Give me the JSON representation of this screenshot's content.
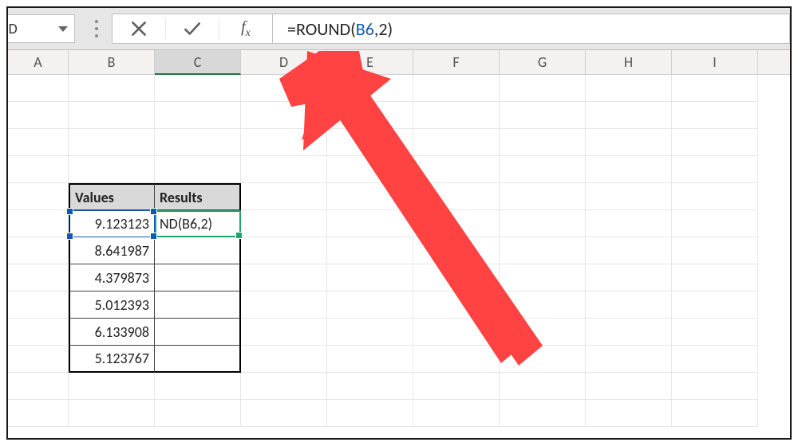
{
  "namebox": {
    "value": "ND"
  },
  "formula_bar": {
    "prefix": "=ROUND(",
    "ref": "B6",
    "suffix": ",2)"
  },
  "columns": [
    "A",
    "B",
    "C",
    "D",
    "E",
    "F",
    "G",
    "H",
    "I"
  ],
  "table": {
    "headers": {
      "b": "Values",
      "c": "Results"
    },
    "active_cell_display": "ND(B6,2)",
    "values": [
      "9.123123",
      "8.641987",
      "4.379873",
      "5.012393",
      "6.133908",
      "5.123767"
    ]
  },
  "chart_data": {
    "type": "table",
    "title": "",
    "columns": [
      "Values",
      "Results"
    ],
    "rows": [
      [
        "9.123123",
        "=ROUND(B6,2)"
      ],
      [
        "8.641987",
        ""
      ],
      [
        "4.379873",
        ""
      ],
      [
        "5.012393",
        ""
      ],
      [
        "6.133908",
        ""
      ],
      [
        "5.123767",
        ""
      ]
    ]
  }
}
